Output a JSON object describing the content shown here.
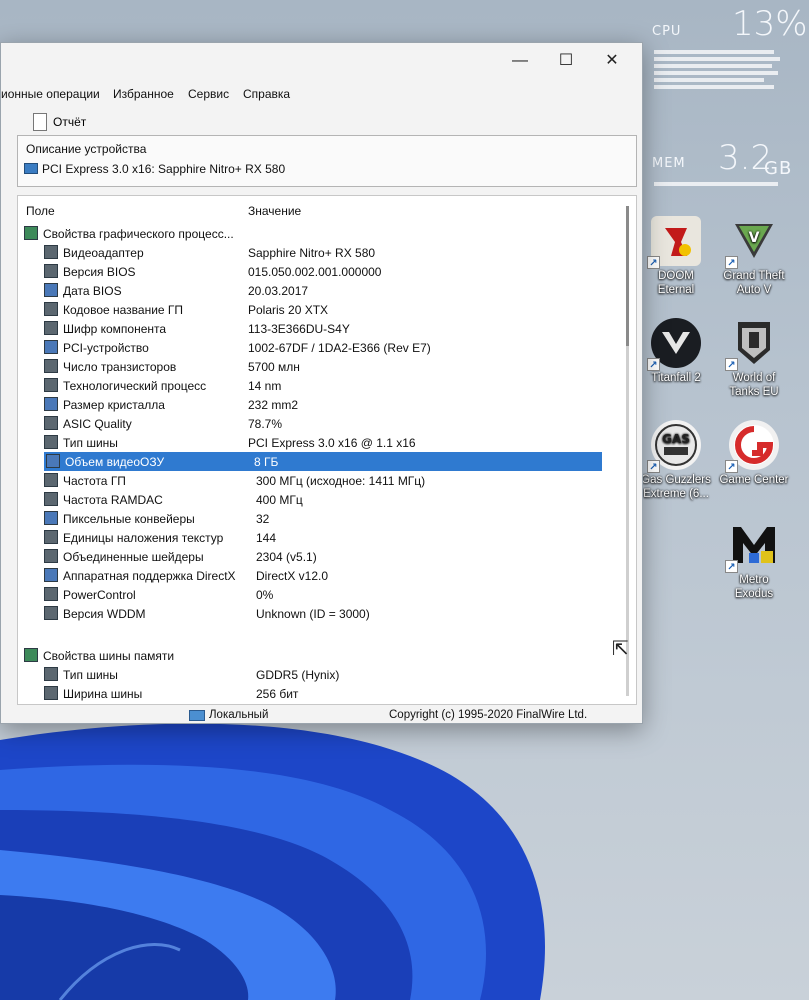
{
  "gadget": {
    "cpu_label": "CPU",
    "cpu_value": "13%",
    "mem_label": "MEM",
    "mem_value": "3.2",
    "mem_unit": "GB"
  },
  "desktop_icons": [
    {
      "label": "DOOM\nEternal",
      "icon": "doom-icon"
    },
    {
      "label": "Grand Theft\nAuto V",
      "icon": "gta-icon"
    },
    {
      "label": "Titanfall 2",
      "icon": "titanfall-icon"
    },
    {
      "label": "World of\nTanks EU",
      "icon": "wot-icon"
    },
    {
      "label": "Gas Guzzlers\nExtreme (6...",
      "icon": "gas-guzzlers-icon"
    },
    {
      "label": "Game Center",
      "icon": "game-center-icon"
    },
    {
      "label": "Metro\nExodus",
      "icon": "metro-icon"
    }
  ],
  "window": {
    "title_buttons": {
      "minimize": "—",
      "maximize": "☐",
      "close": "✕"
    },
    "menu": [
      "ионные операции",
      "Избранное",
      "Сервис",
      "Справка"
    ],
    "toolbar": {
      "report": "Отчёт"
    },
    "description": {
      "title": "Описание устройства",
      "value": "PCI Express 3.0 x16: Sapphire Nitro+ RX 580"
    },
    "columns": {
      "field": "Поле",
      "value": "Значение"
    },
    "rows": [
      {
        "name": "Свойства графического процесс...",
        "value": "",
        "group": true
      },
      {
        "name": "Видеоадаптер",
        "value": "Sapphire Nitro+ RX 580"
      },
      {
        "name": "Версия BIOS",
        "value": "015.050.002.001.000000"
      },
      {
        "name": "Дата BIOS",
        "value": "20.03.2017"
      },
      {
        "name": "Кодовое название ГП",
        "value": "Polaris 20 XTX"
      },
      {
        "name": "Шифр компонента",
        "value": "113-3E366DU-S4Y"
      },
      {
        "name": "PCI-устройство",
        "value": "1002-67DF / 1DA2-E366  (Rev E7)"
      },
      {
        "name": "Число транзисторов",
        "value": "5700 млн"
      },
      {
        "name": "Технологический процесс",
        "value": "14 nm"
      },
      {
        "name": "Размер кристалла",
        "value": "232 mm2"
      },
      {
        "name": "ASIC Quality",
        "value": "78.7%"
      },
      {
        "name": "Тип шины",
        "value": "PCI Express 3.0 x16 @ 1.1 x16"
      },
      {
        "name": "Объем видеоОЗУ",
        "value": "8 ГБ",
        "selected": true
      },
      {
        "name": "Частота ГП",
        "value": "300 МГц  (исходное: 1411 МГц)"
      },
      {
        "name": "Частота RAMDAC",
        "value": "400 МГц"
      },
      {
        "name": "Пиксельные конвейеры",
        "value": "32"
      },
      {
        "name": "Единицы наложения текстур",
        "value": "144"
      },
      {
        "name": "Объединенные шейдеры",
        "value": "2304  (v5.1)"
      },
      {
        "name": "Аппаратная поддержка DirectX",
        "value": "DirectX v12.0"
      },
      {
        "name": "PowerControl",
        "value": "0%"
      },
      {
        "name": "Версия WDDM",
        "value": "Unknown (ID = 3000)"
      },
      {
        "name": "Свойства шины памяти",
        "value": "",
        "group": true
      },
      {
        "name": "Тип шины",
        "value": "GDDR5 (Hynix)"
      },
      {
        "name": "Ширина шины",
        "value": "256 бит"
      }
    ],
    "status": {
      "location": "Локальный",
      "copyright": "Copyright (c) 1995-2020 FinalWire Ltd."
    }
  },
  "colors": {
    "selection": "#2f7ad0",
    "wallpaper_blue": "#1f4fd6"
  }
}
